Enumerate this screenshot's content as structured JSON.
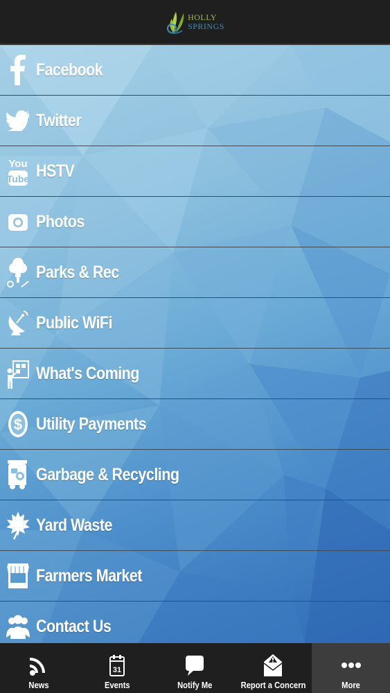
{
  "header": {
    "logo_line1": "HOLLY",
    "logo_line2": "SPRINGS"
  },
  "menu": [
    {
      "label": "Facebook",
      "icon": "facebook-icon"
    },
    {
      "label": "Twitter",
      "icon": "twitter-icon"
    },
    {
      "label": "HSTV",
      "icon": "youtube-icon"
    },
    {
      "label": "Photos",
      "icon": "camera-icon"
    },
    {
      "label": "Parks & Rec",
      "icon": "tree-icon"
    },
    {
      "label": "Public WiFi",
      "icon": "satellite-dish-icon"
    },
    {
      "label": "What's Coming",
      "icon": "presentation-icon"
    },
    {
      "label": "Utility Payments",
      "icon": "dollar-coin-icon"
    },
    {
      "label": "Garbage & Recycling",
      "icon": "garbage-truck-icon"
    },
    {
      "label": "Yard Waste",
      "icon": "leaf-icon"
    },
    {
      "label": "Farmers Market",
      "icon": "market-stall-icon"
    },
    {
      "label": "Contact Us",
      "icon": "people-icon"
    }
  ],
  "tabs": [
    {
      "label": "News",
      "icon": "rss-icon",
      "active": false
    },
    {
      "label": "Events",
      "icon": "calendar-icon",
      "active": false,
      "calendar_day": "31"
    },
    {
      "label": "Notify Me",
      "icon": "chat-bubble-icon",
      "active": false
    },
    {
      "label": "Report a Concern",
      "icon": "envelope-warning-icon",
      "active": false
    },
    {
      "label": "More",
      "icon": "more-dots-icon",
      "active": true
    }
  ],
  "colors": {
    "header_bg": "#201f1f",
    "tabbar_bg": "#1f1f1f",
    "active_tab_bg": "#3d3d3d",
    "logo_green": "#9bbf3a",
    "logo_blue": "#3f8fb8",
    "menu_text": "#ffffff",
    "divider": "#3c4b57"
  }
}
